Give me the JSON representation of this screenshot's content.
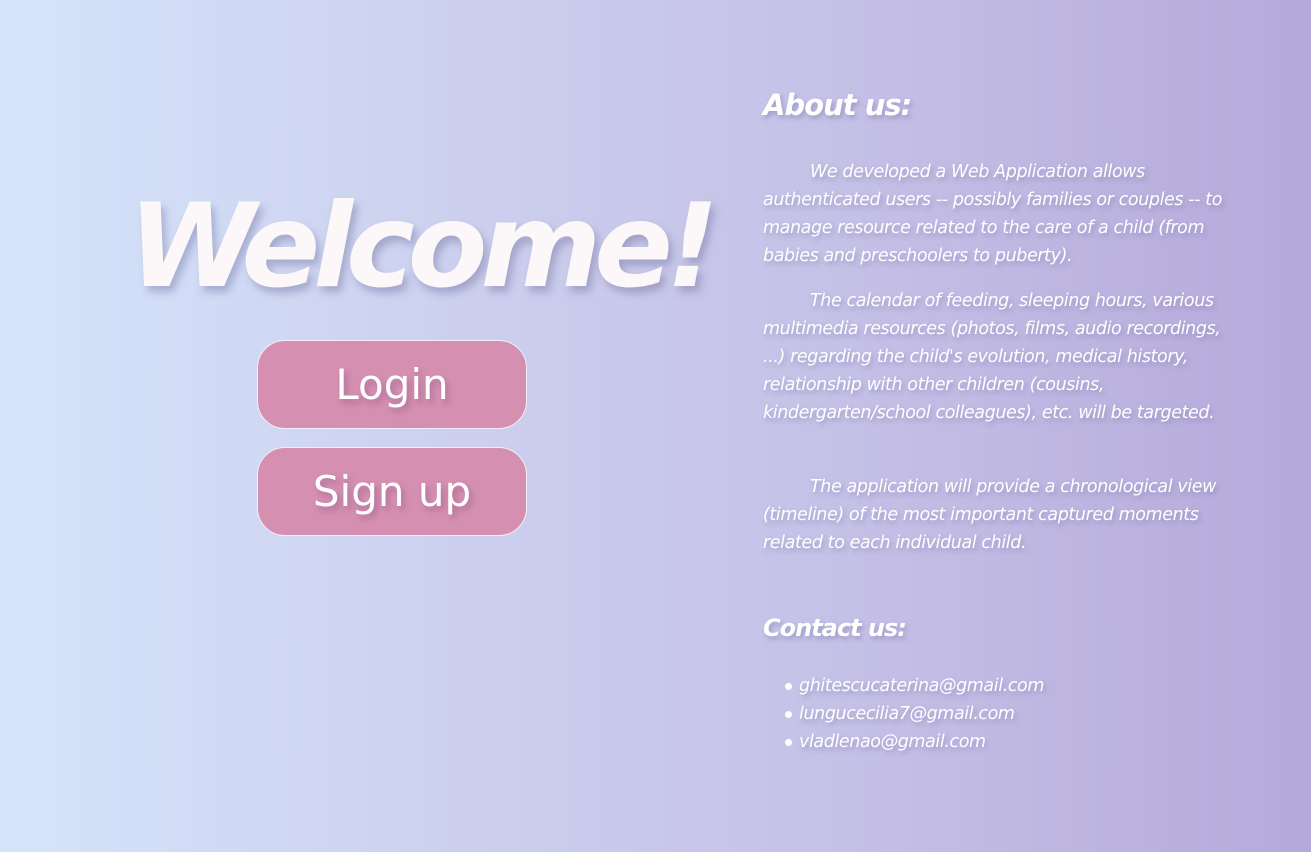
{
  "hero": {
    "title": "Welcome!"
  },
  "buttons": {
    "login_label": "Login",
    "signup_label": "Sign up"
  },
  "about": {
    "heading": "About us:",
    "paragraphs": [
      "We developed a Web Application allows authenticated users -- possibly families or couples -- to manage resource related to the care of a child (from babies and preschoolers to puberty).",
      "The calendar of feeding, sleeping hours, various multimedia resources (photos, films, audio recordings, ...) regarding the child's evolution, medical history, relationship with other children (cousins, kindergarten/school colleagues), etc. will be targeted.",
      "The application will provide a chronological view (timeline) of the most important captured moments related to each individual child."
    ]
  },
  "contact": {
    "heading": "Contact us:",
    "emails": [
      "ghitescucaterina@gmail.com",
      "lungucecilia7@gmail.com",
      "vladlenao@gmail.com"
    ]
  },
  "colors": {
    "background_left": "#d5e4fb",
    "background_right": "#b5a9da",
    "button_fill": "#d48fb1",
    "text": "#ffffff"
  }
}
